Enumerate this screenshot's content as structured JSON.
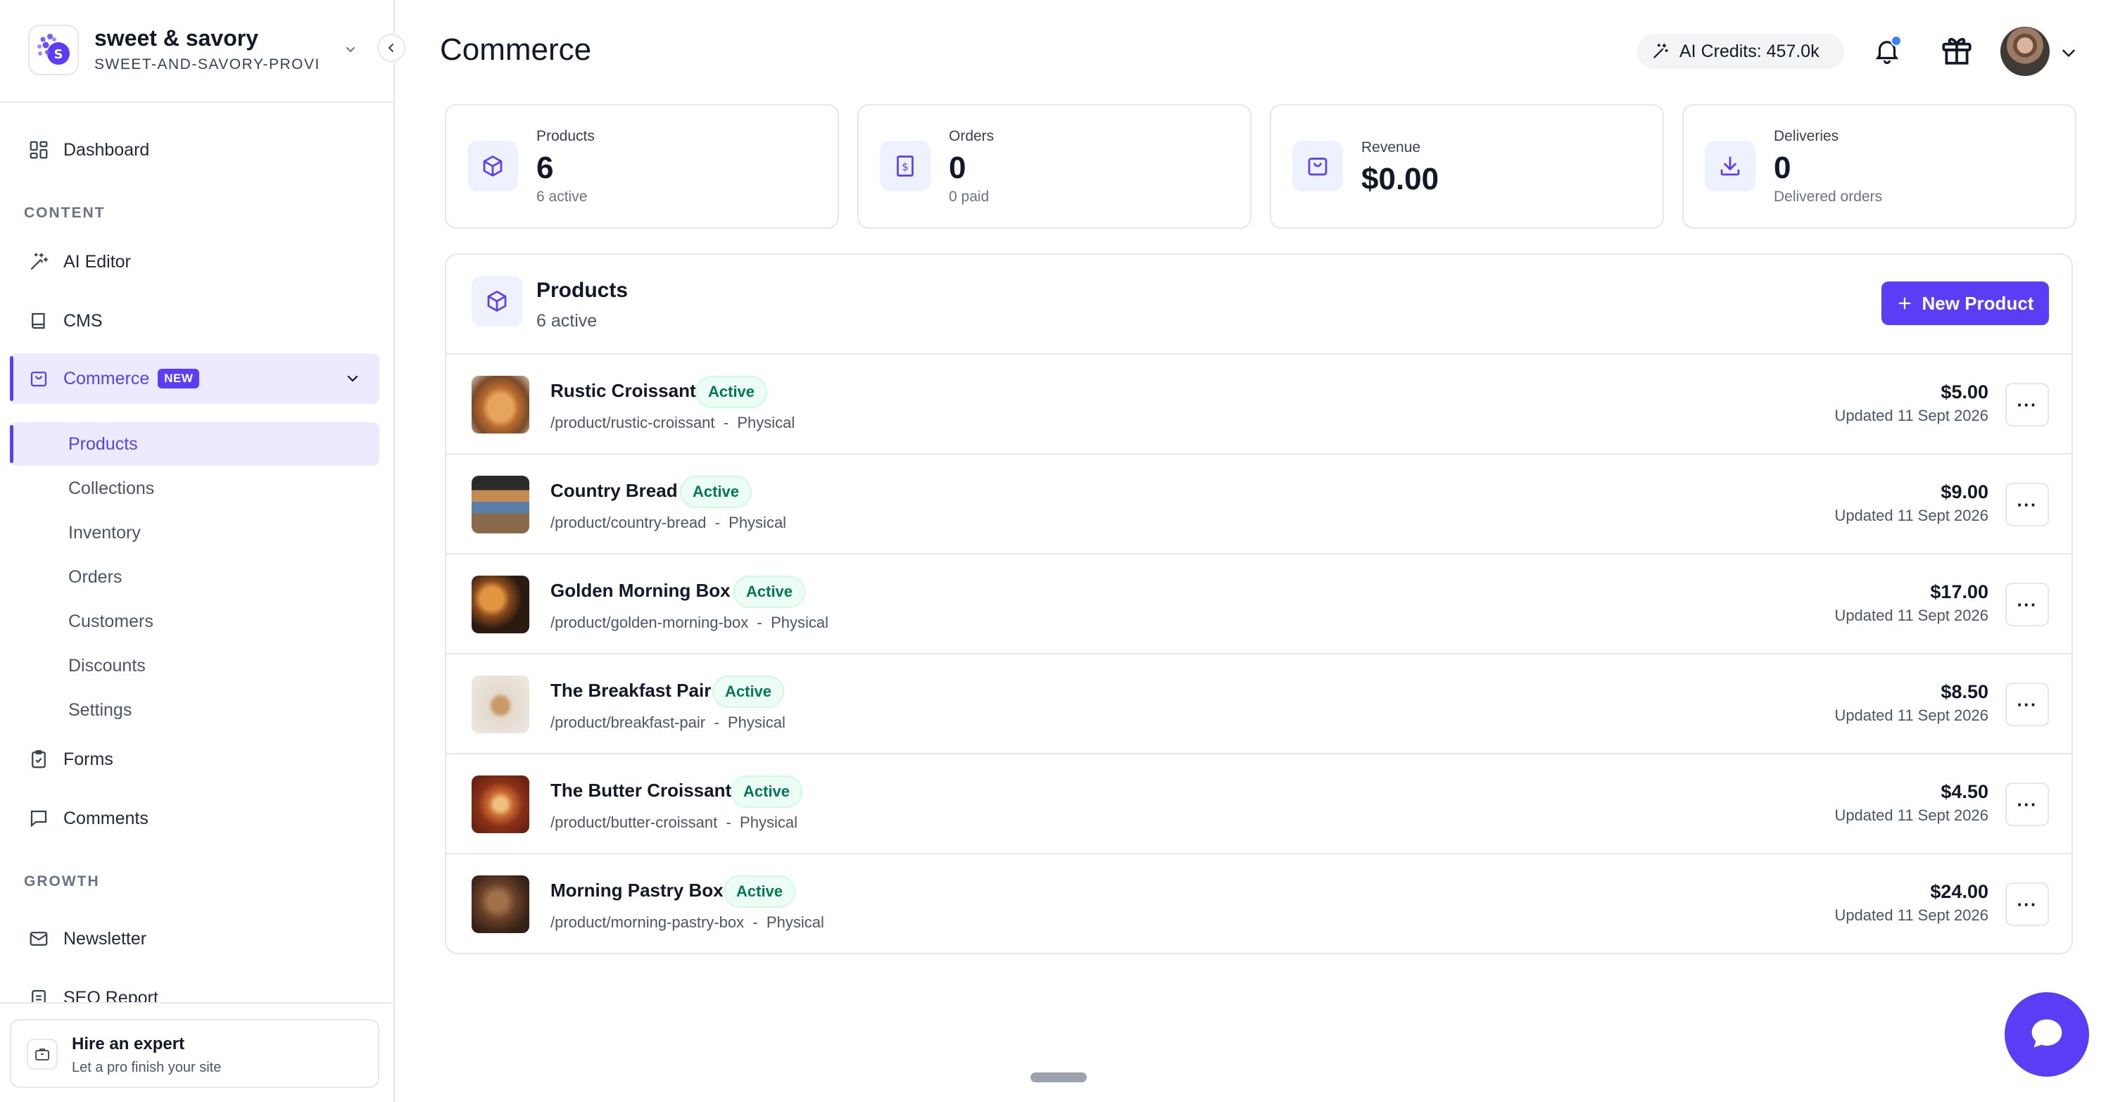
{
  "brand": {
    "name": "sweet & savory",
    "slug": "SWEET-AND-SAVORY-PROVI..."
  },
  "sidebar": {
    "items": [
      {
        "label": "Dashboard",
        "icon": "dashboard-icon"
      },
      {
        "label": "AI Editor",
        "icon": "sparkles-icon"
      },
      {
        "label": "CMS",
        "icon": "book-icon"
      },
      {
        "label": "Commerce",
        "icon": "shopping-bag-icon",
        "badge": "NEW"
      },
      {
        "label": "Forms",
        "icon": "clipboard-icon"
      },
      {
        "label": "Comments",
        "icon": "comment-icon"
      },
      {
        "label": "Newsletter",
        "icon": "mail-icon"
      },
      {
        "label": "SEO Report",
        "icon": "report-icon"
      }
    ],
    "sections": {
      "content": "CONTENT",
      "growth": "GROWTH"
    },
    "commerce_sub": [
      "Products",
      "Collections",
      "Inventory",
      "Orders",
      "Customers",
      "Discounts",
      "Settings"
    ],
    "footer": {
      "title": "Hire an expert",
      "subtitle": "Let a pro finish your site"
    }
  },
  "header": {
    "title": "Commerce",
    "credits": "AI Credits: 457.0k"
  },
  "stats": [
    {
      "label": "Products",
      "value": "6",
      "sub": "6 active",
      "icon": "package-icon"
    },
    {
      "label": "Orders",
      "value": "0",
      "sub": "0 paid",
      "icon": "receipt-icon"
    },
    {
      "label": "Revenue",
      "value": "$0.00",
      "sub": "",
      "icon": "bag-icon"
    },
    {
      "label": "Deliveries",
      "value": "0",
      "sub": "Delivered orders",
      "icon": "download-icon"
    }
  ],
  "products_panel": {
    "title": "Products",
    "subtitle": "6 active",
    "new_button": "New Product",
    "separator": "-",
    "rows": [
      {
        "name": "Rustic Croissant",
        "status": "Active",
        "path": "/product/rustic-croissant",
        "type": "Physical",
        "price": "$5.00",
        "updated": "Updated 11 Sept 2026"
      },
      {
        "name": "Country Bread",
        "status": "Active",
        "path": "/product/country-bread",
        "type": "Physical",
        "price": "$9.00",
        "updated": "Updated 11 Sept 2026"
      },
      {
        "name": "Golden Morning Box",
        "status": "Active",
        "path": "/product/golden-morning-box",
        "type": "Physical",
        "price": "$17.00",
        "updated": "Updated 11 Sept 2026"
      },
      {
        "name": "The Breakfast Pair",
        "status": "Active",
        "path": "/product/breakfast-pair",
        "type": "Physical",
        "price": "$8.50",
        "updated": "Updated 11 Sept 2026"
      },
      {
        "name": "The Butter Croissant",
        "status": "Active",
        "path": "/product/butter-croissant",
        "type": "Physical",
        "price": "$4.50",
        "updated": "Updated 11 Sept 2026"
      },
      {
        "name": "Morning Pastry Box",
        "status": "Active",
        "path": "/product/morning-pastry-box",
        "type": "Physical",
        "price": "$24.00",
        "updated": "Updated 11 Sept 2026"
      }
    ],
    "more_label": "···"
  },
  "colors": {
    "accent": "#5b3df5",
    "accent_light": "#ede9fe",
    "active_status_bg": "#ecfdf5",
    "active_status_text": "#047857",
    "notification_dot": "#3b82f6"
  }
}
